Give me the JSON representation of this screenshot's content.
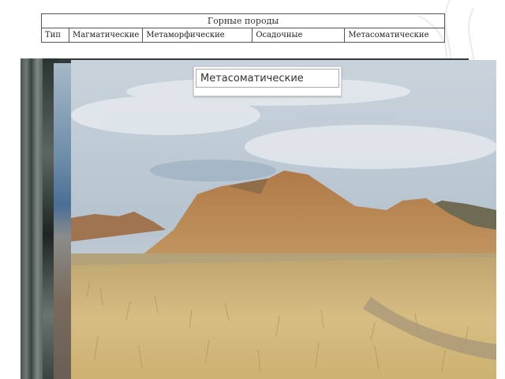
{
  "table": {
    "title": "Горные породы",
    "columns": [
      "Тип",
      "Магматические",
      "Метаморфические",
      "Осадочные",
      "Метасоматические"
    ]
  },
  "photo": {
    "caption": "Метасоматические"
  },
  "colors": {
    "sky": "#b9c6d2",
    "hill": "#b98a58",
    "grass": "#d2b878"
  }
}
